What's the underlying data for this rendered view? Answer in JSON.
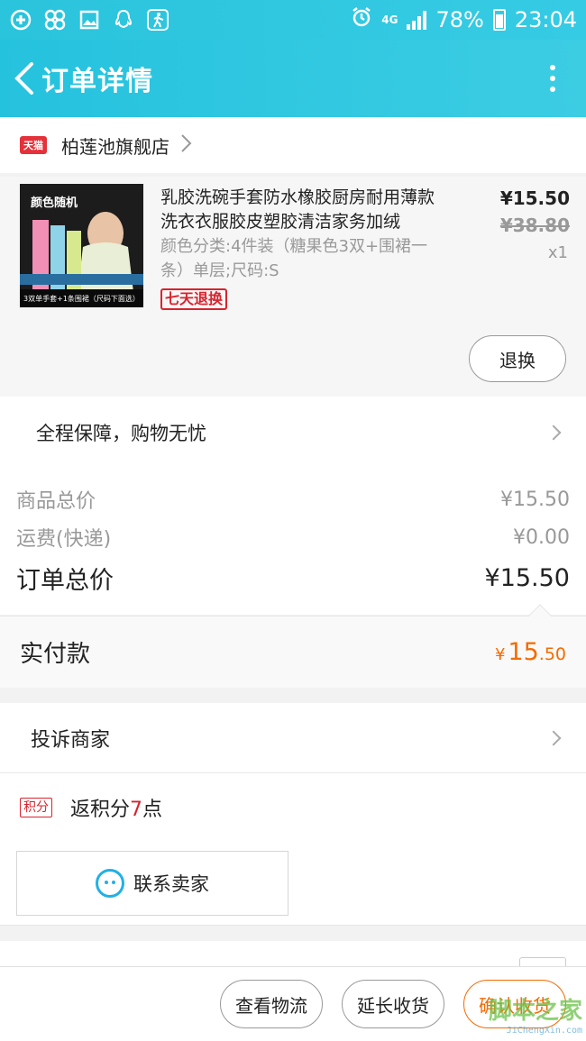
{
  "status_bar": {
    "battery": "78%",
    "time": "23:04",
    "network": "4G",
    "icons": [
      "health-plus-icon",
      "clover-icon",
      "gallery-icon",
      "qq-icon",
      "running-man-icon",
      "alarm-icon",
      "signal-icon",
      "battery-icon"
    ]
  },
  "header": {
    "title": "订单详情"
  },
  "shop": {
    "badge": "天猫",
    "name": "柏莲池旗舰店"
  },
  "item": {
    "thumb_tag": "颜色随机",
    "thumb_caption": "3双单手套+1条围裙（尺码下面选）",
    "title": "乳胶洗碗手套防水橡胶厨房耐用薄款洗衣衣服胶皮塑胶清洁家务加绒",
    "spec": "颜色分类:4件装（糖果色3双+围裙一条）单层;尺码:S",
    "return_badge": "七天退换",
    "price": "¥15.50",
    "original_price": "¥38.80",
    "quantity": "x1",
    "refund_button": "退换"
  },
  "guarantee": {
    "label": "全程保障，购物无忧"
  },
  "summary": {
    "goods_total_label": "商品总价",
    "goods_total_value": "¥15.50",
    "shipping_label": "运费(快递)",
    "shipping_value": "¥0.00",
    "order_total_label": "订单总价",
    "order_total_value": "¥15.50"
  },
  "paid": {
    "label": "实付款",
    "currency": "¥",
    "amount_int": "15",
    "amount_dec": ".50"
  },
  "complain": {
    "label": "投诉商家"
  },
  "points": {
    "badge": "积分",
    "prefix": "返积分",
    "number": "7",
    "suffix": "点"
  },
  "contact": {
    "label": "联系卖家"
  },
  "bottom_bar": {
    "view_logistics": "查看物流",
    "extend_receipt": "延长收货",
    "confirm_receipt": "确认收货"
  },
  "watermark": {
    "main": "脚本之家",
    "sub": "JiChengXin.com"
  },
  "colors": {
    "header_bg": "#2ac4dc",
    "accent_orange": "#f56a00",
    "tmall_red": "#e4313a"
  }
}
